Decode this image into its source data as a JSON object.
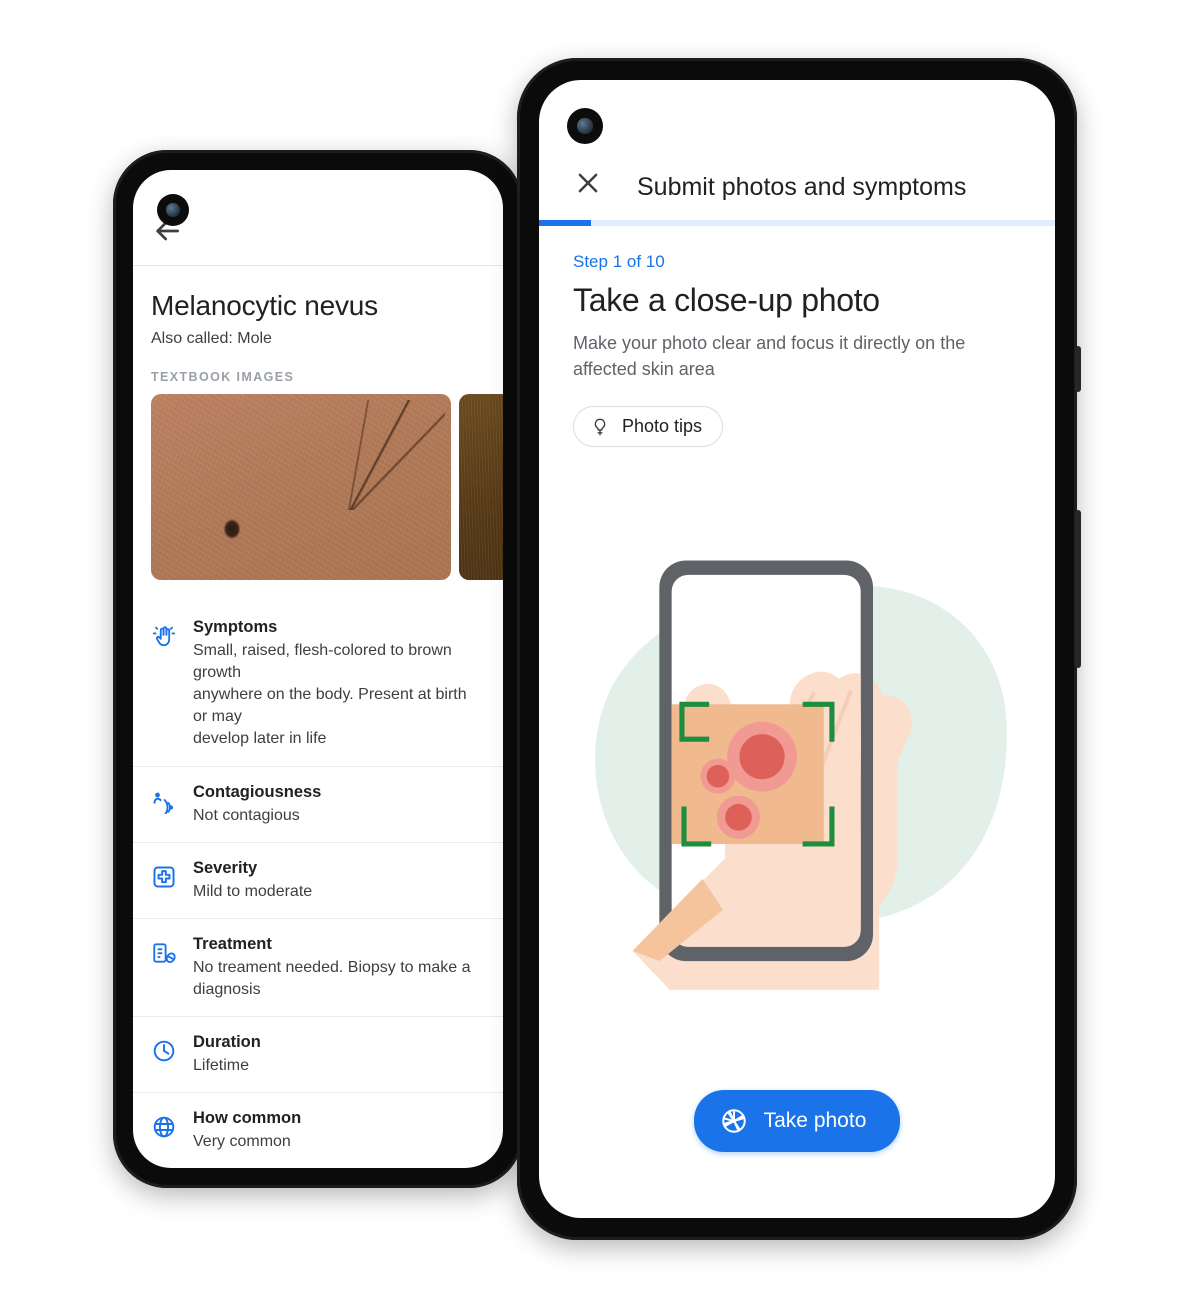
{
  "left_phone": {
    "appbar": {
      "back_icon": "arrow-left-icon"
    },
    "title": "Melanocytic nevus",
    "subtitle": "Also called: Mole",
    "section_label": "TEXTBOOK IMAGES",
    "photos": [
      {
        "alt": "textbook-image-1"
      },
      {
        "alt": "textbook-image-2"
      }
    ],
    "items": [
      {
        "icon": "touch-hand-icon",
        "title": "Symptoms",
        "text": "Small, raised, flesh-colored to brown growth\nanywhere on the body. Present at birth or may\ndevelop later in life"
      },
      {
        "icon": "contagious-spread-icon",
        "title": "Contagiousness",
        "text": "Not contagious"
      },
      {
        "icon": "medical-cross-icon",
        "title": "Severity",
        "text": "Mild to moderate"
      },
      {
        "icon": "prescription-pill-icon",
        "title": "Treatment",
        "text": "No treament needed. Biopsy to make a diagnosis"
      },
      {
        "icon": "clock-icon",
        "title": "Duration",
        "text": "Lifetime"
      },
      {
        "icon": "globe-icon",
        "title": "How common",
        "text": "Very common"
      }
    ]
  },
  "right_phone": {
    "appbar": {
      "close_icon": "close-icon",
      "title": "Submit photos and symptoms"
    },
    "progress": {
      "percent": 10
    },
    "step_label": "Step 1 of 10",
    "title": "Take a close-up photo",
    "description": "Make your photo clear and focus it directly on the affected skin area",
    "chip": {
      "icon": "lightbulb-icon",
      "label": "Photo tips"
    },
    "illustration": {
      "name": "hand-with-skin-lesions-in-camera-frame",
      "blob_color": "#e3f0ea",
      "phone_frame_color": "#5f6368",
      "focus_bracket_color": "#1e8e3e",
      "skin_color": "#f8ded0",
      "skin_patch_color": "#f0b98e",
      "lesion_color": "#e8736a"
    },
    "cta": {
      "icon": "camera-aperture-icon",
      "label": "Take photo"
    }
  },
  "colors": {
    "accent": "#1a73e8",
    "text_primary": "#202124",
    "text_secondary": "#5f6368",
    "bezel": "#0b0b0b"
  }
}
